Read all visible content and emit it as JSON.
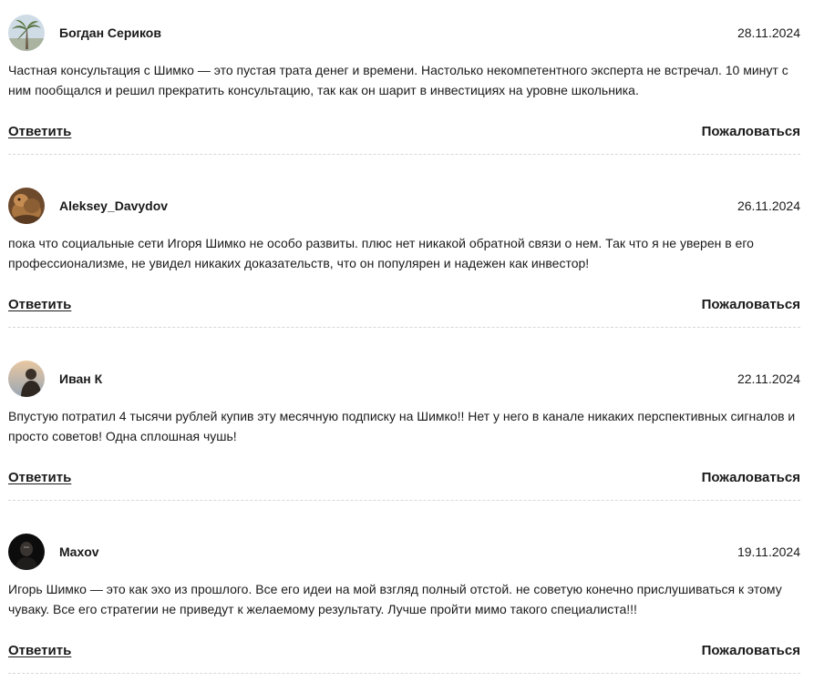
{
  "comments": [
    {
      "author": "Богдан Сериков",
      "date": "28.11.2024",
      "text": "Частная консультация с Шимко — это пустая трата денег и времени. Настолько некомпетентного эксперта не встречал. 10 минут с ним пообщался и решил прекратить консультацию, так как он шарит в инвестициях на уровне школьника.",
      "reply_label": "Ответить",
      "report_label": "Пожаловаться",
      "avatar_icon": "palm-tree-avatar"
    },
    {
      "author": "Aleksey_Davydov",
      "date": "26.11.2024",
      "text": "пока что социальные сети Игоря Шимко не особо развиты. плюс нет никакой обратной связи о нем. Так что я не уверен в его профессионализме, не увидел никаких доказательств, что он популярен и надежен как инвестор!",
      "reply_label": "Ответить",
      "report_label": "Пожаловаться",
      "avatar_icon": "camel-avatar"
    },
    {
      "author": "Иван К",
      "date": "22.11.2024",
      "text": "Впустую потратил 4 тысячи рублей купив эту месячную подписку на Шимко!! Нет у него в канале никаких перспективных сигналов и просто советов! Одна сплошная чушь!",
      "reply_label": "Ответить",
      "report_label": "Пожаловаться",
      "avatar_icon": "person-silhouette-avatar"
    },
    {
      "author": "Maxov",
      "date": "19.11.2024",
      "text": "Игорь Шимко — это как эхо из прошлого. Все его идеи на мой взгляд полный отстой. не советую конечно прислушиваться к этому чуваку. Все его стратегии не приведут к желаемому результату. Лучше пройти мимо такого специалиста!!!",
      "reply_label": "Ответить",
      "report_label": "Пожаловаться",
      "avatar_icon": "dark-portrait-avatar"
    }
  ]
}
